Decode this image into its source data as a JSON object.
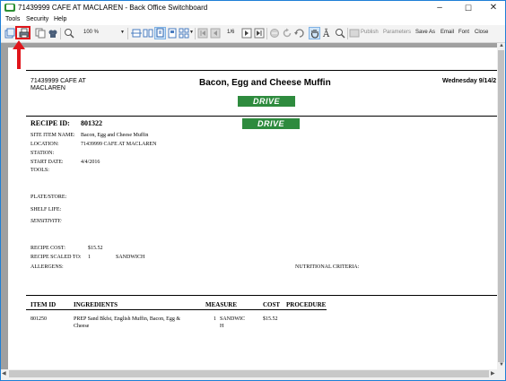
{
  "window": {
    "title": "71439999 CAFE AT MACLAREN - Back Office Switchboard",
    "minimize": "–",
    "maximize": "☐",
    "close": "✕"
  },
  "menu": [
    "Tools",
    "Security",
    "Help"
  ],
  "toolbar": {
    "zoom": "100 %",
    "page_indicator": "1/6",
    "publish": "Publish",
    "parameters": "Parameters",
    "save_as": "Save As",
    "email": "Email",
    "font": "Font",
    "close": "Close"
  },
  "report": {
    "location_header_line1": "71439999 CAFE AT",
    "location_header_line2": "MACLAREN",
    "title": "Bacon, Egg and Cheese Muffin",
    "date": "Wednesday 9/14/2",
    "logo_text": "DRIVE",
    "recipe_id_label": "RECIPE ID:",
    "recipe_id": "801322",
    "site_item_name_label": "SITE ITEM NAME:",
    "site_item_name": "Bacon, Egg and Cheese Muffin",
    "location_label": "LOCATION:",
    "location": "71439999 CAFE AT MACLAREN",
    "station_label": "STATION:",
    "start_date_label": "START DATE:",
    "start_date": "4/4/2016",
    "tools_label": "TOOLS:",
    "plate_store_label": "PLATE/STORE:",
    "shelf_life_label": "SHELF LIFE:",
    "sensitivity_label": "SENSITIVITY:",
    "recipe_cost_label": "RECIPE COST:",
    "recipe_cost": "$15.52",
    "recipe_scaled_label": "RECIPE SCALED TO:",
    "recipe_scaled_qty": "1",
    "recipe_scaled_unit": "SANDWICH",
    "allergens_label": "ALLERGENS:",
    "nutritional_label": "NUTRITIONAL CRITERIA:",
    "table_headers": [
      "ITEM ID",
      "INGREDIENTS",
      "MEASURE",
      "COST",
      "PROCEDURE"
    ],
    "rows": [
      {
        "item_id": "801250",
        "ingredients_line1": "PREP Sand Bkfst, English Muffin, Bacon, Egg &",
        "ingredients_line2": "Cheese",
        "qty": "1",
        "measure_line1": "SANDWIC",
        "measure_line2": "H",
        "cost": "$15.52"
      }
    ]
  },
  "annotation_color": "#e0151b"
}
